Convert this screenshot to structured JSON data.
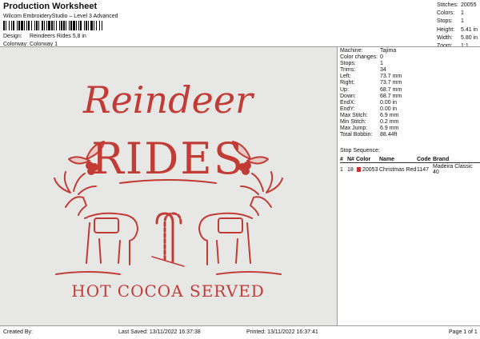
{
  "header": {
    "title": "Production Worksheet",
    "subtitle": "Wilcom EmbroideryStudio – Level 3 Advanced",
    "design_label": "Design:",
    "design_value": "Reindeers Rides 5,8 in",
    "colorway_label": "Colorway:",
    "colorway_value": "Colorway 1"
  },
  "summary": {
    "stitches_label": "Stitches:",
    "stitches_value": "20055",
    "colors_label": "Colors:",
    "colors_value": "1",
    "stops_label": "Stops:",
    "stops_value": "1",
    "height_label": "Height:",
    "height_value": "5.41 in",
    "width_label": "Width:",
    "width_value": "5.80 in",
    "zoom_label": "Zoom:",
    "zoom_value": "1:1"
  },
  "design": {
    "line1": "Reindeer",
    "line2": "RIDES",
    "line3": "HOT COCOA SERVED",
    "thread_color": "#c23c36",
    "background": "#e7e7e6"
  },
  "stats": [
    {
      "label": "Machine:",
      "value": "Tajima"
    },
    {
      "label": "Color changes:",
      "value": "0"
    },
    {
      "label": "Stops:",
      "value": "1"
    },
    {
      "label": "Trims:",
      "value": "34"
    },
    {
      "label": "Left:",
      "value": "73.7 mm"
    },
    {
      "label": "Right:",
      "value": "73.7 mm"
    },
    {
      "label": "Up:",
      "value": "68.7 mm"
    },
    {
      "label": "Down:",
      "value": "68.7 mm"
    },
    {
      "label": "EndX:",
      "value": "0.00 in"
    },
    {
      "label": "EndY:",
      "value": "0.00 in"
    },
    {
      "label": "Max Stitch:",
      "value": "6.9 mm"
    },
    {
      "label": "Min Stitch:",
      "value": "0.2 mm"
    },
    {
      "label": "Max Jump:",
      "value": "6.9 mm"
    },
    {
      "label": "Total Bobbin:",
      "value": "88.44ft"
    }
  ],
  "stop_sequence": {
    "title": "Stop Sequence:",
    "columns": [
      "#",
      "N#",
      "Color",
      "Name",
      "Code",
      "Brand"
    ],
    "rows": [
      {
        "num": "1",
        "n": "18",
        "color": "20053",
        "name": "Christmas Red",
        "code": "1147",
        "brand": "Madeira Classic 40",
        "swatch": "#c8322f"
      }
    ]
  },
  "footer": {
    "created_by": "Created By:",
    "last_saved": "Last Saved: 13/11/2022 16:37:38",
    "printed": "Printed: 13/11/2022 16:37:41",
    "page": "Page 1 of 1"
  }
}
